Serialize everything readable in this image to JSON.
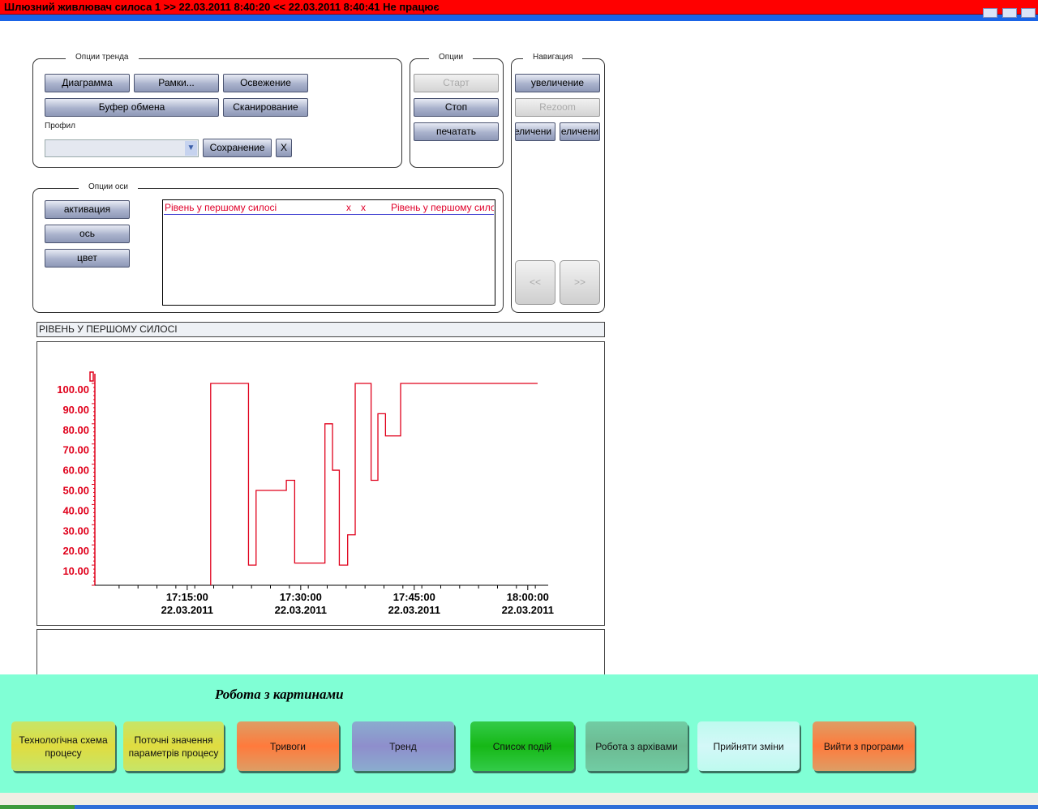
{
  "window": {
    "title": "Шлюзний живлювач силоса 1 >> 22.03.2011 8:40:20 << 22.03.2011 8:40:41  Не працює"
  },
  "trend_options": {
    "legend": "Опции тренда",
    "diagram": "Диаграмма",
    "frames": "Рамки...",
    "refresh": "Освежение",
    "clipboard": "Буфер обмена",
    "scan": "Сканирование",
    "profile_label": "Профил",
    "profile_value": "",
    "save": "Сохранение",
    "close": "X"
  },
  "options": {
    "legend": "Опции",
    "start": "Старт",
    "stop": "Стоп",
    "print": "печатать"
  },
  "navigation": {
    "legend": "Навигация",
    "zoom_in": "увеличение",
    "rezoom": "Rezoom",
    "zoom_a": "еличени",
    "zoom_b": "еличени",
    "prev": "<<",
    "next": ">>"
  },
  "axis_options": {
    "legend": "Опции оси",
    "activate": "активация",
    "axis": "ось",
    "color": "цвет"
  },
  "pens": [
    {
      "name": "Рівень у першому силосі",
      "c1": "x",
      "c2": "x",
      "desc": "Рівень у першому силосі"
    }
  ],
  "trend_title": "РІВЕНЬ У ПЕРШОМУ СИЛОСІ",
  "chart_data": {
    "type": "line",
    "step": true,
    "title": "РІВЕНЬ У ПЕРШОМУ СИЛОСІ",
    "color": "#e0001b",
    "xlabel": "",
    "ylabel": "",
    "x_unit": "minutes after 17:00:00 22.03.2011",
    "xlim": [
      2.8,
      62.7
    ],
    "ylim": [
      0,
      100
    ],
    "y_ticks": [
      "10.00",
      "20.00",
      "30.00",
      "40.00",
      "50.00",
      "60.00",
      "70.00",
      "80.00",
      "90.00",
      "100.00"
    ],
    "y_tick_values": [
      10,
      20,
      30,
      40,
      50,
      60,
      70,
      80,
      90,
      100
    ],
    "x_ticks": [
      {
        "value": 15,
        "time": "17:15:00",
        "date": "22.03.2011"
      },
      {
        "value": 30,
        "time": "17:30:00",
        "date": "22.03.2011"
      },
      {
        "value": 45,
        "time": "17:45:00",
        "date": "22.03.2011"
      },
      {
        "value": 60,
        "time": "18:00:00",
        "date": "22.03.2011"
      }
    ],
    "points": [
      [
        18.1,
        0
      ],
      [
        18.1,
        100
      ],
      [
        23.1,
        10
      ],
      [
        24.1,
        47
      ],
      [
        28.1,
        52
      ],
      [
        29.2,
        11
      ],
      [
        33.2,
        80
      ],
      [
        34.2,
        57
      ],
      [
        35.1,
        10
      ],
      [
        36.2,
        25
      ],
      [
        37.2,
        100
      ],
      [
        39.3,
        52
      ],
      [
        40.2,
        85
      ],
      [
        41.2,
        74
      ],
      [
        43.2,
        100
      ],
      [
        61.3,
        100
      ]
    ]
  },
  "bottom": {
    "title": "Робота з картинами",
    "buttons": [
      {
        "label": "Технологічна схема процесу",
        "color": "#e0dc40"
      },
      {
        "label": "Поточні значення параметрів процесу",
        "color": "#e0dc40"
      },
      {
        "label": "Тривоги",
        "color": "#ff7a3c"
      },
      {
        "label": "Тренд",
        "color": "#8e8ecc"
      },
      {
        "label": "Список подій",
        "color": "#16b816"
      },
      {
        "label": "Робота з архівами",
        "color": "#6cba92"
      },
      {
        "label": "Прийняти зміни",
        "color": "#d4f8f8"
      },
      {
        "label": "Вийти з програми",
        "color": "#ff7a3c"
      }
    ]
  }
}
